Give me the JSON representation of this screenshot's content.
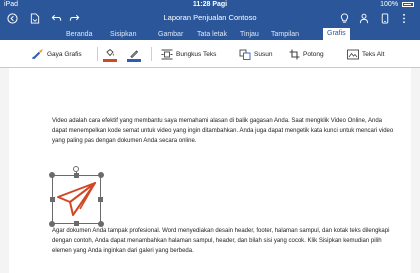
{
  "status": {
    "device": "iPad",
    "time": "11:28 Pagi",
    "battery": "100%"
  },
  "titlebar": {
    "title": "Laporan Penjualan Contoso"
  },
  "tabs": [
    "Beranda",
    "Sisipkan",
    "Gambar",
    "Tata letak",
    "Tinjau",
    "Tampilan",
    "Grafis"
  ],
  "active_tab": "Grafis",
  "toolbar": {
    "styles_label": "Gaya Grafis",
    "wrap_label": "Bungkus Teks",
    "arrange_label": "Susun",
    "crop_label": "Potong",
    "alt_text_label": "Teks Alt",
    "fill_color": "#d24726",
    "line_color": "#2b5cb8"
  },
  "document": {
    "paragraph1": "Video adalah cara efektif yang membantu saya memahami alasan di balik gagasan Anda. Saat mengklik Video Online, Anda dapat menempelkan kode semat untuk video yang ingin ditambahkan. Anda juga dapat mengetik kata kunci untuk mencari video yang paling pas dengan dokumen Anda secara online.",
    "paragraph2": "Agar dokumen Anda tampak profesional. Word menyediakan desain header, footer, halaman sampul, dan kotak teks dilengkapi dengan contoh, Anda dapat menambahkan halaman sampul, header, dan bilah sisi yang cocok. Klik Sisipkan kemudian pilih elemen yang Anda inginkan dari galeri yang berbeda."
  },
  "graphic": {
    "icon": "paper-plane-icon",
    "color": "#d24726"
  }
}
